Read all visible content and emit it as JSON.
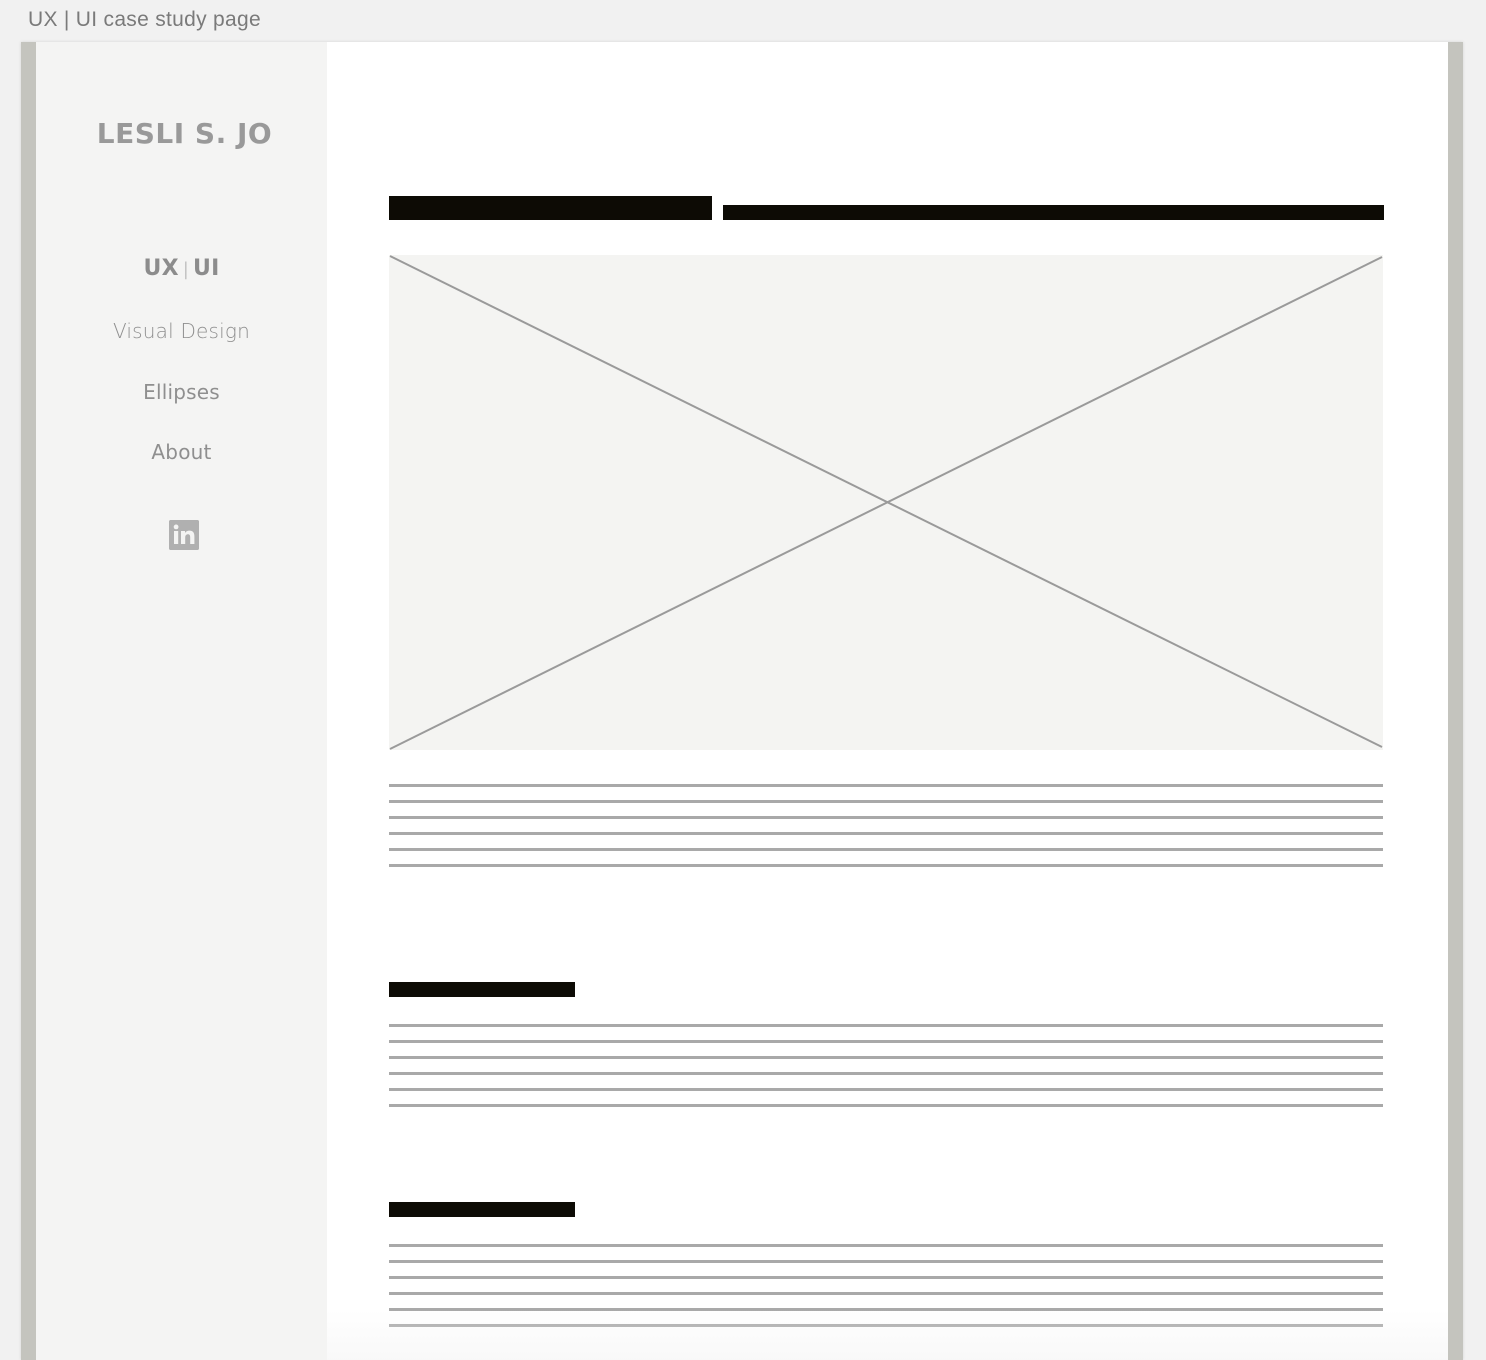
{
  "frame": {
    "label": "UX | UI case study page"
  },
  "sidebar": {
    "logo": "LESLI S. JO",
    "nav": {
      "active_left": "UX",
      "active_separator": "|",
      "active_right": "UI",
      "visual_design": "Visual Design",
      "ellipses": "Ellipses",
      "about": "About"
    },
    "social_icon": "linkedin-icon"
  },
  "main": {
    "hero_image": "image-placeholder",
    "sections": [
      {
        "heading": "heading-placeholder",
        "paragraph_lines": 6
      },
      {
        "heading": "heading-placeholder",
        "paragraph_lines": 6
      }
    ],
    "intro_paragraph_lines": 6
  },
  "colors": {
    "sidebar_bg": "#f4f4f3",
    "frame_border": "#c4c4be",
    "text_block": "#0d0b05",
    "text_line": "#a9a9a9",
    "nav_text": "#8f8f8f",
    "image_bg": "#f4f4f2"
  }
}
